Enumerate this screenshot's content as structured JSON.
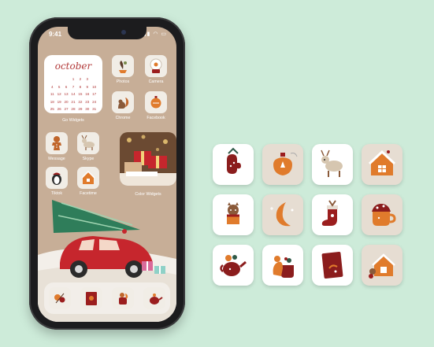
{
  "status": {
    "time": "9:41",
    "signal": "▮▮ ◠ ▭"
  },
  "calendar": {
    "month": "october",
    "rows": [
      [
        "",
        "",
        "",
        "1",
        "2",
        "3",
        ""
      ],
      [
        "4",
        "5",
        "6",
        "7",
        "8",
        "9",
        "10"
      ],
      [
        "11",
        "12",
        "13",
        "14",
        "15",
        "16",
        "17"
      ],
      [
        "18",
        "19",
        "20",
        "21",
        "22",
        "23",
        "24"
      ],
      [
        "25",
        "26",
        "27",
        "28",
        "29",
        "30",
        "31"
      ]
    ],
    "widget_label": "Go Widgets"
  },
  "apps": {
    "photos": "Photos",
    "camera": "Camera",
    "chrome": "Chrome",
    "facebook": "Facebook",
    "message": "Message",
    "skype": "Skype",
    "tiktok": "Tiktok",
    "facetime": "Facetime"
  },
  "photo_widget_label": "Color Widgets",
  "colors": {
    "background": "#cdebd9",
    "phone_screen": "#c7ae97",
    "accent_red": "#9b1e1e",
    "accent_orange": "#e07b2c",
    "tile_white": "#ffffff",
    "tile_beige": "#e6ddd2"
  }
}
